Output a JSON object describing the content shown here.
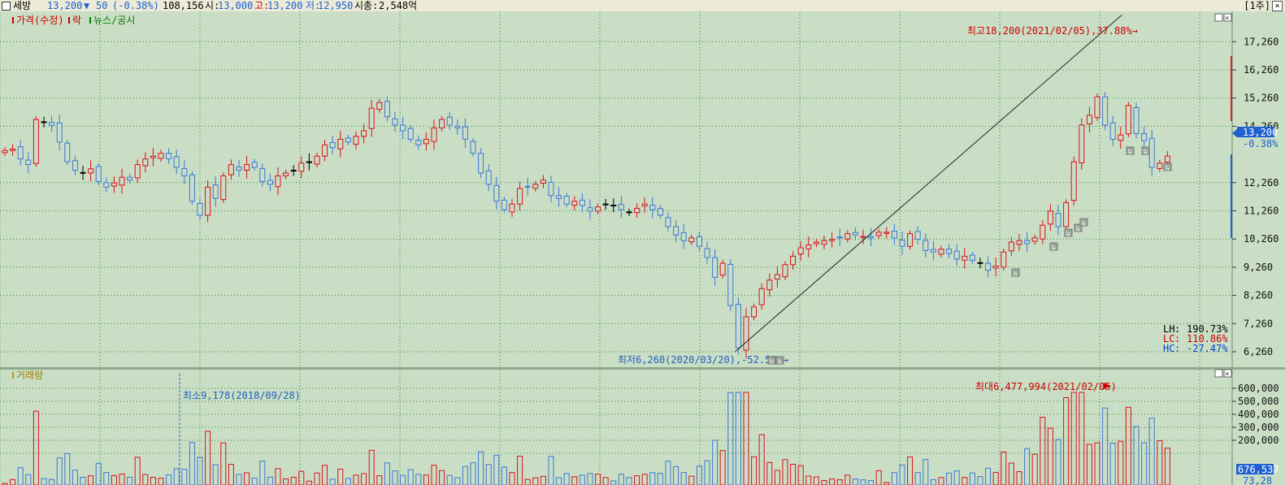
{
  "header": {
    "stock_name": "세방",
    "price": "13,200",
    "change_arrow": "▼",
    "change": "50",
    "change_pct": "(-0.38%)",
    "volume": "108,156",
    "open_label": "시:",
    "open": "13,000",
    "high_label": "고:",
    "high": "13,200",
    "low_label": "저:",
    "low": "12,950",
    "mcap_label": "시총:",
    "mcap": "2,548억",
    "period": "[1주]",
    "close_icon": "x-icon"
  },
  "price_panel": {
    "legend": [
      "가격(수정)",
      "락",
      "뉴스/공시"
    ],
    "legend_colors": [
      "#cc0000",
      "#cc0000",
      "#008000"
    ],
    "y_ticks": [
      "17,260",
      "16,260",
      "15,260",
      "14,260",
      "12,260",
      "11,260",
      "10,260",
      "9,260",
      "8,260",
      "7,260",
      "6,260"
    ],
    "current_price_tag": "13,200",
    "current_change_tag": "-0.38%",
    "max_annotation": "최고18,200(2021/02/05),37.88%→",
    "min_annotation": "최저6,260(2020/03/20),-52.58%→",
    "stats": [
      {
        "label": "LH",
        "value": "190.73%",
        "color": "#000000"
      },
      {
        "label": "LC",
        "value": "110.86%",
        "color": "#cc0000"
      },
      {
        "label": "HC",
        "value": "-27.47%",
        "color": "#0044cc"
      }
    ],
    "news_marker_label": "뉴"
  },
  "volume_panel": {
    "legend": "거래량",
    "min_annotation": "최소9,178(2018/09/28)",
    "max_annotation": "최대6,477,994(2021/02/05)",
    "y_ticks": [
      "600,000",
      "500,000",
      "400,000",
      "300,000",
      "200,000"
    ],
    "current_volume_tag": "676,537",
    "partial_tag": "73,28"
  },
  "colors": {
    "up": "#e0101a",
    "down": "#3c78d8",
    "flat": "#000000",
    "background": "#c9dec5",
    "grid": "#2e8b2e"
  },
  "chart_data": {
    "type": "candlestick",
    "interval": "weekly",
    "y_axis_ticks": [
      6260,
      7260,
      8260,
      9260,
      10260,
      11260,
      12260,
      14260,
      15260,
      16260,
      17260
    ],
    "last_candle": {
      "open": 13000,
      "high": 13200,
      "low": 12950,
      "close": 13200,
      "volume": 108156
    },
    "period_high": {
      "value": 18200,
      "date": "2021/02/05",
      "pct": 37.88
    },
    "period_low": {
      "value": 6260,
      "date": "2020/03/20",
      "pct": -52.58
    },
    "volume_min": {
      "value": 9178,
      "date": "2018/09/28"
    },
    "volume_max": {
      "value": 6477994,
      "date": "2021/02/05"
    },
    "close_series": [
      13400,
      13450,
      13100,
      12900,
      14500,
      14400,
      14300,
      13700,
      13000,
      12700,
      12600,
      12750,
      12300,
      12100,
      12250,
      12450,
      12350,
      12900,
      13100,
      13200,
      13300,
      13100,
      12800,
      12500,
      11600,
      11100,
      12100,
      11700,
      12500,
      12900,
      12700,
      12900,
      12800,
      12300,
      12200,
      12500,
      12600,
      12700,
      12950,
      13000,
      13200,
      13600,
      13500,
      13800,
      13700,
      13900,
      14100,
      14900,
      15100,
      14600,
      14300,
      14100,
      13800,
      13600,
      13800,
      14200,
      14500,
      14300,
      14200,
      13800,
      13300,
      12600,
      12200,
      11600,
      11300,
      11500,
      12050,
      12100,
      12200,
      12350,
      11800,
      11700,
      11500,
      11600,
      11450,
      11250,
      11400,
      11500,
      11450,
      11300,
      11200,
      11350,
      11500,
      11300,
      11100,
      10700,
      10400,
      10200,
      10300,
      10000,
      9600,
      8900,
      9400,
      7900,
      6400,
      7500,
      7850,
      8500,
      8800,
      9000,
      9350,
      9650,
      9950,
      10050,
      10150,
      10200,
      10250,
      10300,
      10450,
      10400,
      10350,
      10300,
      10500,
      10500,
      10300,
      10000,
      10450,
      10250,
      9850,
      9800,
      9900,
      9750,
      9550,
      9650,
      9500,
      9400,
      9150,
      9300,
      9800,
      10150,
      10200,
      10100,
      10300,
      10750,
      11250,
      10700,
      11550,
      13000,
      14300,
      14650,
      15300,
      14300,
      13800,
      13950,
      15000,
      14000,
      13750,
      12800,
      12950,
      13200
    ]
  }
}
